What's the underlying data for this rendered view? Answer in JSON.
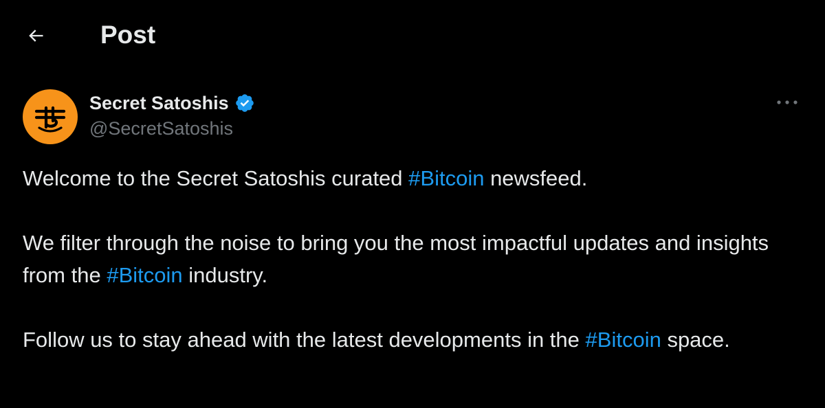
{
  "header": {
    "title": "Post",
    "back_icon": "arrow-left-icon"
  },
  "author": {
    "display_name": "Secret Satoshis",
    "handle": "@SecretSatoshis",
    "verified_icon": "verified-badge-icon",
    "avatar_color": "#f7931a",
    "more_icon": "more-dots-icon"
  },
  "tweet": {
    "p1": {
      "before": "Welcome to the Secret Satoshis curated ",
      "hashtag": "#Bitcoin",
      "after": " newsfeed."
    },
    "p2": {
      "before": "We filter through the noise to bring you the most impactful updates and insights from the ",
      "hashtag": "#Bitcoin",
      "after": " industry."
    },
    "p3": {
      "before": "Follow us to stay ahead with the latest developments in the ",
      "hashtag": "#Bitcoin",
      "after": " space."
    }
  },
  "colors": {
    "background": "#000000",
    "text": "#e7e9ea",
    "muted": "#71767b",
    "accent": "#1d9bf0"
  }
}
